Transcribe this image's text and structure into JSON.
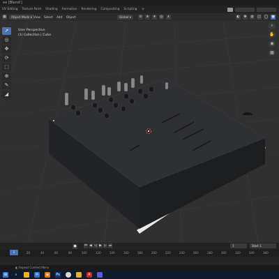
{
  "window": {
    "title": "ee [Blend!]"
  },
  "workspaces": [
    "UV Editing",
    "Texture Paint",
    "Shading",
    "Animation",
    "Rendering",
    "Compositing",
    "Scripting",
    "+"
  ],
  "header": {
    "mode": "Object Mode",
    "menus": [
      "View",
      "Select",
      "Add",
      "Object"
    ],
    "orientation": "Global"
  },
  "viewport": {
    "view_name": "User Perspective",
    "collection": "(1) Collection | Cube"
  },
  "tools": [
    "select-box",
    "cursor",
    "move",
    "rotate",
    "scale",
    "transform",
    "annotate",
    "measure"
  ],
  "timeline": {
    "ticks": [
      "0",
      "20",
      "40",
      "60",
      "80",
      "100",
      "120",
      "140",
      "160",
      "180",
      "200",
      "220",
      "240",
      "260",
      "280",
      "300",
      "320",
      "340",
      "360",
      "380"
    ],
    "current_frame": "1",
    "start_label": "Start",
    "start_value": "1"
  },
  "status": {
    "text": "Repeat Context Menu"
  },
  "taskbar": [
    "windows-icon",
    "search-icon",
    "file-explorer-icon",
    "mail-icon",
    "blender-icon",
    "photoshop-icon",
    "chrome-icon",
    "folder-icon",
    "acrobat-icon",
    "app-icon"
  ],
  "colors": {
    "accent": "#4a72b5",
    "panel": "#2b2b2b",
    "viewport": "#303030"
  }
}
